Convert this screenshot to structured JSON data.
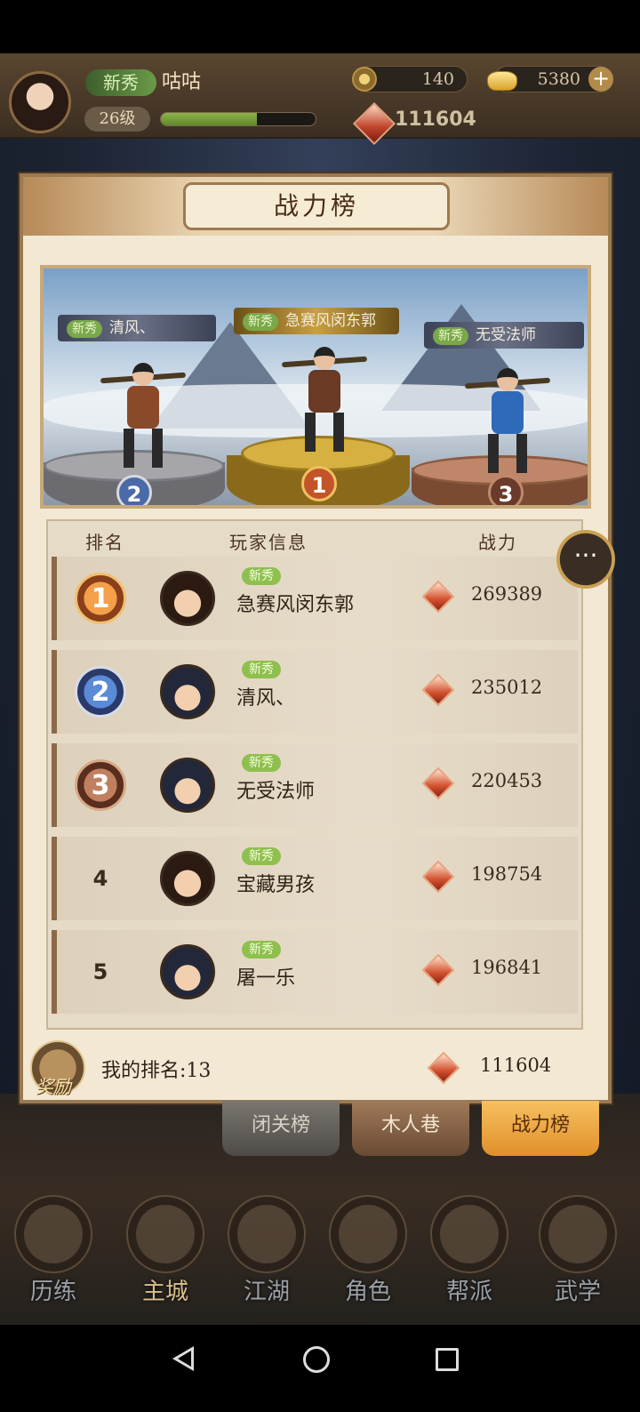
{
  "player": {
    "rank_tag": "新秀",
    "name": "咕咕",
    "level": "26级",
    "exp_fraction": 0.62,
    "silver": "140",
    "gold": "5380",
    "power": "111604"
  },
  "panel": {
    "title": "战力榜"
  },
  "podium": {
    "second": {
      "tag": "新秀",
      "name": "清风、",
      "place": "2"
    },
    "first": {
      "tag": "新秀",
      "name": "急赛风闵东郭",
      "place": "1"
    },
    "third": {
      "tag": "新秀",
      "name": "无受法师",
      "place": "3"
    }
  },
  "table": {
    "headers": {
      "rank": "排名",
      "info": "玩家信息",
      "power": "战力"
    },
    "rows": [
      {
        "rank": "1",
        "tag": "新秀",
        "name": "急赛风闵东郭",
        "power": "269389"
      },
      {
        "rank": "2",
        "tag": "新秀",
        "name": "清风、",
        "power": "235012"
      },
      {
        "rank": "3",
        "tag": "新秀",
        "name": "无受法师",
        "power": "220453"
      },
      {
        "rank": "4",
        "tag": "新秀",
        "name": "宝藏男孩",
        "power": "198754"
      },
      {
        "rank": "5",
        "tag": "新秀",
        "name": "屠一乐",
        "power": "196841"
      }
    ]
  },
  "my": {
    "reward_label": "奖励",
    "rank_text": "我的排名:13",
    "power": "111604"
  },
  "board_tabs": [
    "闭关榜",
    "木人巷",
    "战力榜"
  ],
  "nav": [
    "历练",
    "主城",
    "江湖",
    "角色",
    "帮派",
    "武学"
  ],
  "colors": {
    "accent": "#e0902a",
    "tag_green": "#8fbf4e",
    "panel_bg": "#f2e8d4"
  }
}
